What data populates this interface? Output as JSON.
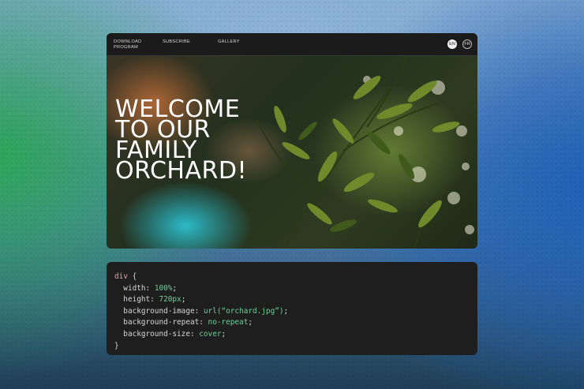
{
  "nav": {
    "links": [
      "DOWNLOAD PROGRAM",
      "SUBSCRIBE",
      "GALLERY"
    ],
    "lang_en": "EN",
    "lang_fr": "FR"
  },
  "hero": {
    "title": "WELCOME TO OUR FAMILY ORCHARD!"
  },
  "code": {
    "selector": "div",
    "open_brace": "{",
    "close_brace": "}",
    "lines": [
      {
        "prop": "width",
        "value": "100%"
      },
      {
        "prop": "height",
        "value": "720px"
      },
      {
        "prop": "background-image",
        "value": "url(“orchard.jpg”)"
      },
      {
        "prop": "background-repeat",
        "value": "no-repeat"
      },
      {
        "prop": "background-size",
        "value": "cover"
      }
    ]
  },
  "colors": {
    "code_property": "#e1a4a8",
    "code_value": "#6fcf97",
    "nav_bg": "#1b1b1b",
    "code_bg": "#1e1e1e"
  }
}
